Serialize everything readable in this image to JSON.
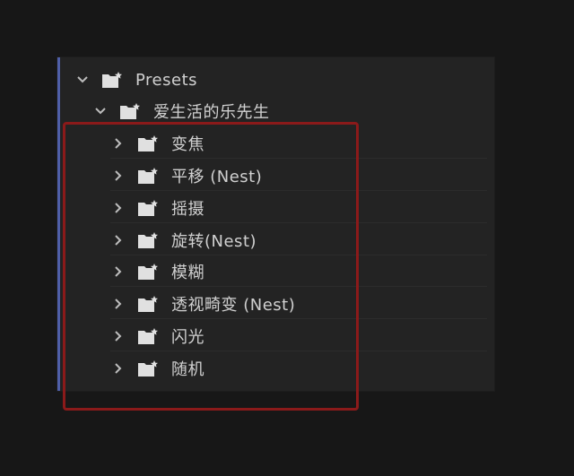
{
  "panel": {
    "root": {
      "label": "Presets",
      "expanded": true
    },
    "group": {
      "label": "爱生活的乐先生",
      "expanded": true
    },
    "items": [
      {
        "label": "变焦"
      },
      {
        "label": "平移 (Nest)"
      },
      {
        "label": "摇摄"
      },
      {
        "label": "旋转(Nest)"
      },
      {
        "label": "模糊"
      },
      {
        "label": "透视畸变 (Nest)"
      },
      {
        "label": "闪光"
      },
      {
        "label": "随机"
      }
    ]
  },
  "colors": {
    "highlight_border": "#8b1a1a",
    "panel_accent": "#4f5fa8"
  },
  "icons": {
    "expanded": "chevron-down-icon",
    "collapsed": "chevron-right-icon",
    "folder": "preset-folder-icon"
  }
}
